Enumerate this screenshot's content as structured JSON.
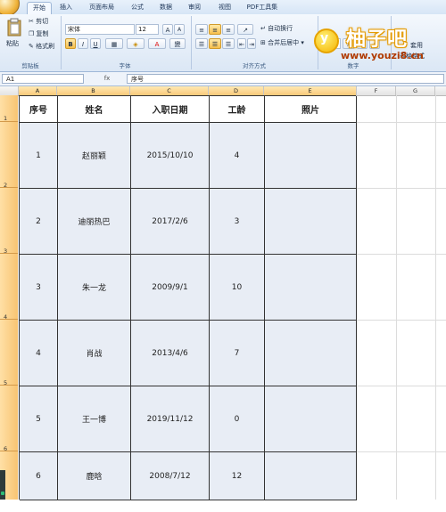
{
  "ribbon": {
    "tabs": [
      "开始",
      "插入",
      "页面布局",
      "公式",
      "数据",
      "审阅",
      "视图",
      "PDF工具集"
    ],
    "clipboard": {
      "paste": "粘贴",
      "cut": "剪切",
      "copy": "复制",
      "format_painter": "格式刷",
      "label": "剪贴板"
    },
    "font": {
      "name": "宋体",
      "size": "12",
      "bold": "B",
      "italic": "I",
      "underline": "U",
      "label": "字体",
      "phonetic": "變"
    },
    "alignment": {
      "wrap": "自动换行",
      "merge": "合并后居中",
      "label": "对齐方式"
    },
    "number": {
      "format": "常规",
      "percent": "%",
      "label": "数字"
    },
    "more": {
      "cond": "套用",
      "cell_style": "表格格式"
    }
  },
  "watermark": {
    "title": "柚子吧",
    "url": "www.youzi8.cn",
    "mark": "y"
  },
  "formula_bar": {
    "name_box": "A1",
    "fx": "fx",
    "content": "序号"
  },
  "columns": [
    "A",
    "B",
    "C",
    "D",
    "E",
    "F",
    "G"
  ],
  "rows": [
    "1",
    "2",
    "3",
    "4",
    "5",
    "6"
  ],
  "table": {
    "headers": [
      "序号",
      "姓名",
      "入职日期",
      "工龄",
      "照片"
    ],
    "rows": [
      [
        "1",
        "赵丽颖",
        "2015/10/10",
        "4",
        ""
      ],
      [
        "2",
        "迪丽热巴",
        "2017/2/6",
        "3",
        ""
      ],
      [
        "3",
        "朱一龙",
        "2009/9/1",
        "10",
        ""
      ],
      [
        "4",
        "肖战",
        "2013/4/6",
        "7",
        ""
      ],
      [
        "5",
        "王一博",
        "2019/11/12",
        "0",
        ""
      ],
      [
        "6",
        "鹿晗",
        "2008/7/12",
        "12",
        ""
      ]
    ]
  }
}
